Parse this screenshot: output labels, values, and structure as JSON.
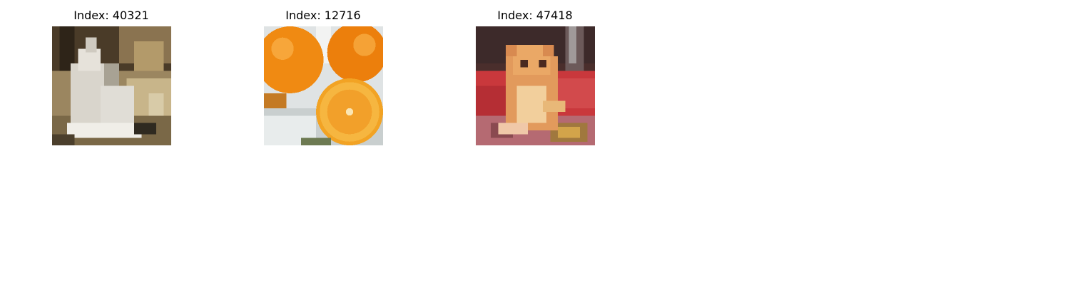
{
  "figure": {
    "panels": [
      {
        "title": "Index: 40321",
        "subject": "white-dog-outdoors"
      },
      {
        "title": "Index: 12716",
        "subject": "oranges-halved"
      },
      {
        "title": "Index: 47418",
        "subject": "hamster-on-red-cloth"
      }
    ]
  }
}
